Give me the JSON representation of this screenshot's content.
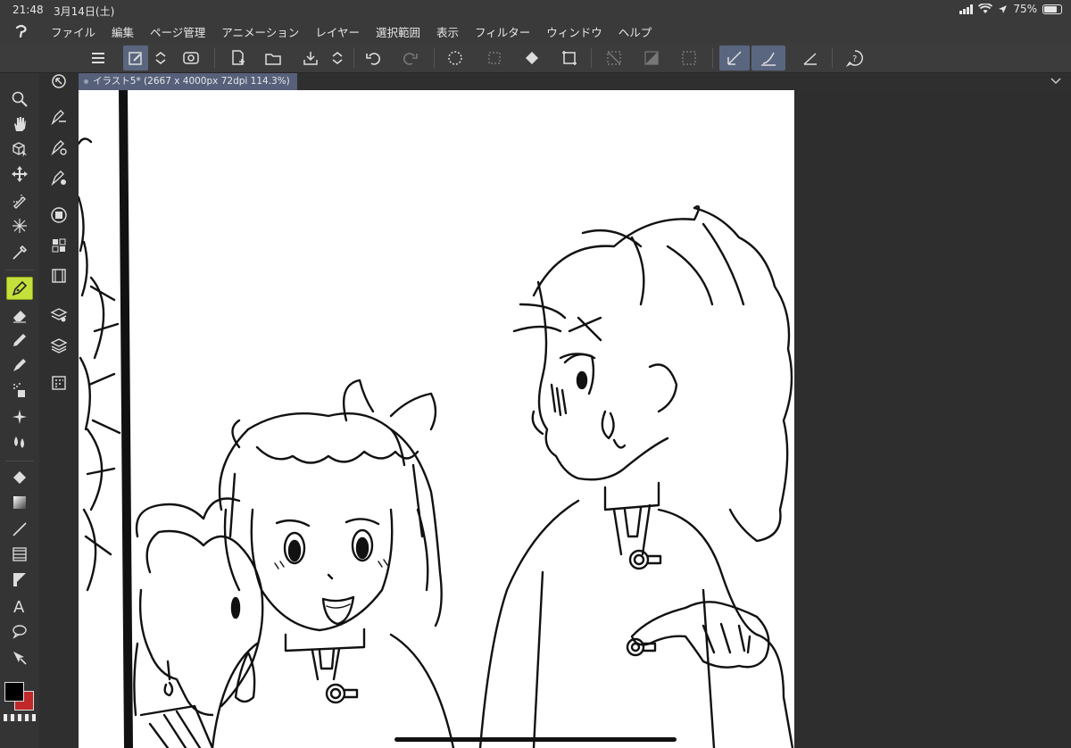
{
  "status_bar": {
    "time": "21:48",
    "date": "3月14日(土)",
    "battery": "75%",
    "battery_level": 0.75
  },
  "menu": {
    "items": [
      "ファイル",
      "編集",
      "ページ管理",
      "アニメーション",
      "レイヤー",
      "選択範囲",
      "表示",
      "フィルター",
      "ウィンドウ",
      "ヘルプ"
    ]
  },
  "panel_header": {
    "collapse_left": "«",
    "collapse_right": "›"
  },
  "document": {
    "tab_title": "イラスト5* (2667 x 4000px 72dpi 114.3%)"
  },
  "tools": {
    "selected": "pen-tool",
    "items": [
      "zoom",
      "hand",
      "3d-object",
      "move",
      "operation",
      "auto-select",
      "eyedropper",
      "pen",
      "eraser",
      "pencil",
      "marker",
      "airbrush",
      "decoration",
      "blend",
      "fill",
      "gradient",
      "figure",
      "frame",
      "ruler",
      "text",
      "balloon",
      "correct-line"
    ]
  },
  "colors": {
    "main": "#000000",
    "sub": "#c0282a",
    "accent": "#c4e03a",
    "selection": "#5a6680"
  }
}
